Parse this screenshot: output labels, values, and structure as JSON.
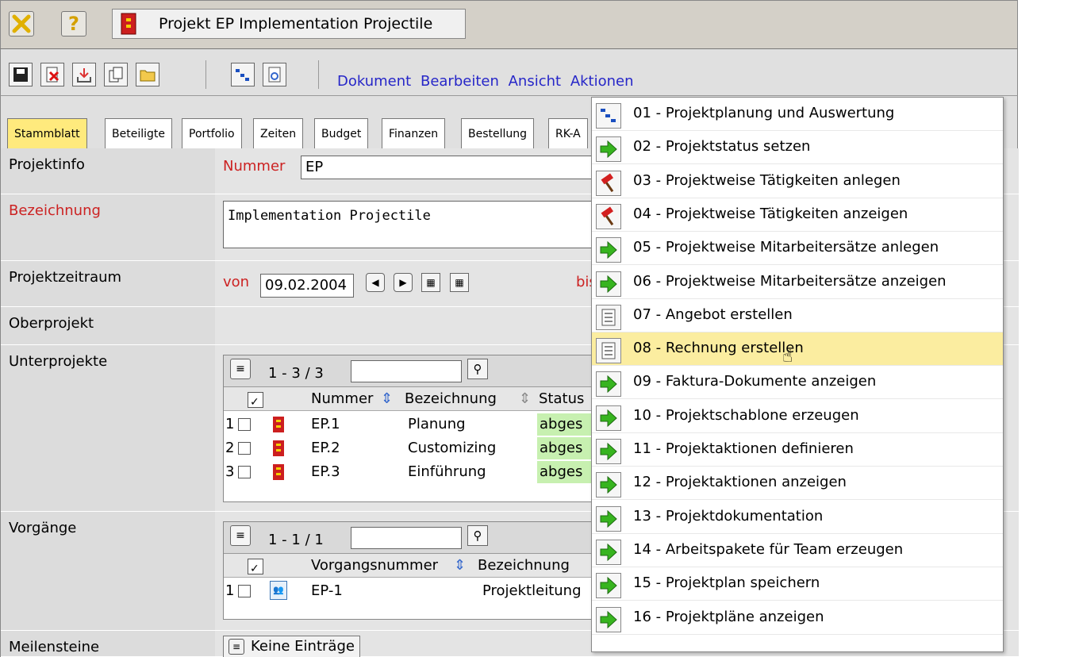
{
  "window": {
    "title": "Projekt EP Implementation Projectile",
    "close_icon": "close-icon",
    "help_icon": "help-icon"
  },
  "menu": {
    "items": [
      "Dokument",
      "Bearbeiten",
      "Ansicht",
      "Aktionen"
    ]
  },
  "tabs": [
    "Stammblatt",
    "Beteiligte",
    "Portfolio",
    "Zeiten",
    "Budget",
    "Finanzen",
    "Bestellung",
    "RK-A"
  ],
  "form": {
    "projektinfo_label": "Projektinfo",
    "nummer_label": "Nummer",
    "nummer_value": "EP",
    "bezeichnung_label": "Bezeichnung",
    "bezeichnung_value": "Implementation Projectile",
    "projektzeitraum_label": "Projektzeitraum",
    "von_label": "von",
    "von_value": "09.02.2004",
    "bis_label": "bis",
    "oberprojekt_label": "Oberprojekt",
    "unterprojekte_label": "Unterprojekte",
    "vorgaenge_label": "Vorgänge",
    "meilensteine_label": "Meilensteine"
  },
  "unterprojekte": {
    "count": "1 - 3 / 3",
    "columns": [
      "Nummer",
      "Bezeichnung",
      "Status"
    ],
    "rows": [
      {
        "index": "1",
        "nummer": "EP.1",
        "bezeichnung": "Planung",
        "status": "abges"
      },
      {
        "index": "2",
        "nummer": "EP.2",
        "bezeichnung": "Customizing",
        "status": "abges"
      },
      {
        "index": "3",
        "nummer": "EP.3",
        "bezeichnung": "Einführung",
        "status": "abges"
      }
    ]
  },
  "vorgaenge": {
    "count": "1 - 1 / 1",
    "columns": [
      "Vorgangsnummer",
      "Bezeichnung"
    ],
    "rows": [
      {
        "index": "1",
        "nummer": "EP-1",
        "bezeichnung": "Projektleitung"
      }
    ]
  },
  "meilensteine": {
    "empty": "Keine Einträge"
  },
  "aktionen_menu": [
    {
      "label": "01 - Projektplanung und Auswertung",
      "icon": "gantt-icon"
    },
    {
      "label": "02 - Projektstatus setzen",
      "icon": "green-arrow-icon"
    },
    {
      "label": "03 - Projektweise Tätigkeiten anlegen",
      "icon": "hammer-icon"
    },
    {
      "label": "04 - Projektweise Tätigkeiten anzeigen",
      "icon": "hammer-icon"
    },
    {
      "label": "05 - Projektweise Mitarbeitersätze anlegen",
      "icon": "green-arrow-icon"
    },
    {
      "label": "06 - Projektweise Mitarbeitersätze anzeigen",
      "icon": "green-arrow-icon"
    },
    {
      "label": "07 - Angebot erstellen",
      "icon": "document-icon"
    },
    {
      "label": "08 - Rechnung erstellen",
      "icon": "document-icon"
    },
    {
      "label": "09 - Faktura-Dokumente anzeigen",
      "icon": "green-arrow-icon"
    },
    {
      "label": "10 - Projektschablone erzeugen",
      "icon": "green-arrow-icon"
    },
    {
      "label": "11 - Projektaktionen definieren",
      "icon": "green-arrow-icon"
    },
    {
      "label": "12 - Projektaktionen anzeigen",
      "icon": "green-arrow-icon"
    },
    {
      "label": "13 - Projektdokumentation",
      "icon": "green-arrow-icon"
    },
    {
      "label": "14 - Arbeitspakete für Team erzeugen",
      "icon": "green-arrow-icon"
    },
    {
      "label": "15 - Projektplan speichern",
      "icon": "green-arrow-icon"
    },
    {
      "label": "16 - Projektpläne anzeigen",
      "icon": "green-arrow-icon"
    }
  ],
  "colors": {
    "accent_tab": "#ffea7d",
    "menu_link": "#2626c8",
    "required_label": "#cc2222",
    "status_bg": "#c7f0b0",
    "highlight_item": "#fbeda0"
  }
}
